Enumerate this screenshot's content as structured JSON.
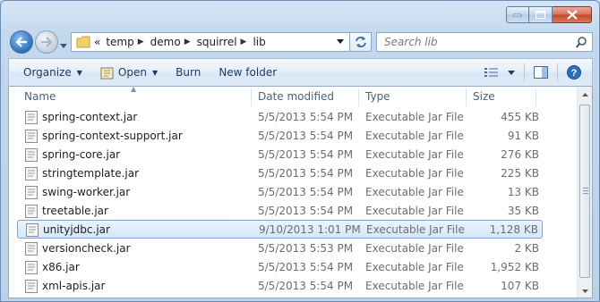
{
  "window": {
    "caption_buttons": [
      "minimize",
      "maximize",
      "close"
    ]
  },
  "address": {
    "overflow": "«",
    "crumbs": [
      "temp",
      "demo",
      "squirrel",
      "lib"
    ]
  },
  "search": {
    "placeholder": "Search lib"
  },
  "toolbar": {
    "organize": "Organize",
    "open": "Open",
    "burn": "Burn",
    "new_folder": "New folder"
  },
  "columns": {
    "name": "Name",
    "date": "Date modified",
    "type": "Type",
    "size": "Size"
  },
  "files": [
    {
      "name": "spring-context.jar",
      "date": "5/5/2013 5:54 PM",
      "type": "Executable Jar File",
      "size": "455 KB"
    },
    {
      "name": "spring-context-support.jar",
      "date": "5/5/2013 5:54 PM",
      "type": "Executable Jar File",
      "size": "91 KB"
    },
    {
      "name": "spring-core.jar",
      "date": "5/5/2013 5:54 PM",
      "type": "Executable Jar File",
      "size": "276 KB"
    },
    {
      "name": "stringtemplate.jar",
      "date": "5/5/2013 5:54 PM",
      "type": "Executable Jar File",
      "size": "225 KB"
    },
    {
      "name": "swing-worker.jar",
      "date": "5/5/2013 5:54 PM",
      "type": "Executable Jar File",
      "size": "13 KB"
    },
    {
      "name": "treetable.jar",
      "date": "5/5/2013 5:54 PM",
      "type": "Executable Jar File",
      "size": "35 KB"
    },
    {
      "name": "unityjdbc.jar",
      "date": "9/10/2013 1:01 PM",
      "type": "Executable Jar File",
      "size": "1,128 KB",
      "selected": true
    },
    {
      "name": "versioncheck.jar",
      "date": "5/5/2013 5:53 PM",
      "type": "Executable Jar File",
      "size": "2 KB"
    },
    {
      "name": "x86.jar",
      "date": "5/5/2013 5:54 PM",
      "type": "Executable Jar File",
      "size": "1,952 KB"
    },
    {
      "name": "xml-apis.jar",
      "date": "5/5/2013 5:54 PM",
      "type": "Executable Jar File",
      "size": "107 KB"
    }
  ],
  "colors": {
    "selection_border": "#7da2ce",
    "selection_fill": "#d4e7fb",
    "toolbar_text": "#1e395b"
  }
}
